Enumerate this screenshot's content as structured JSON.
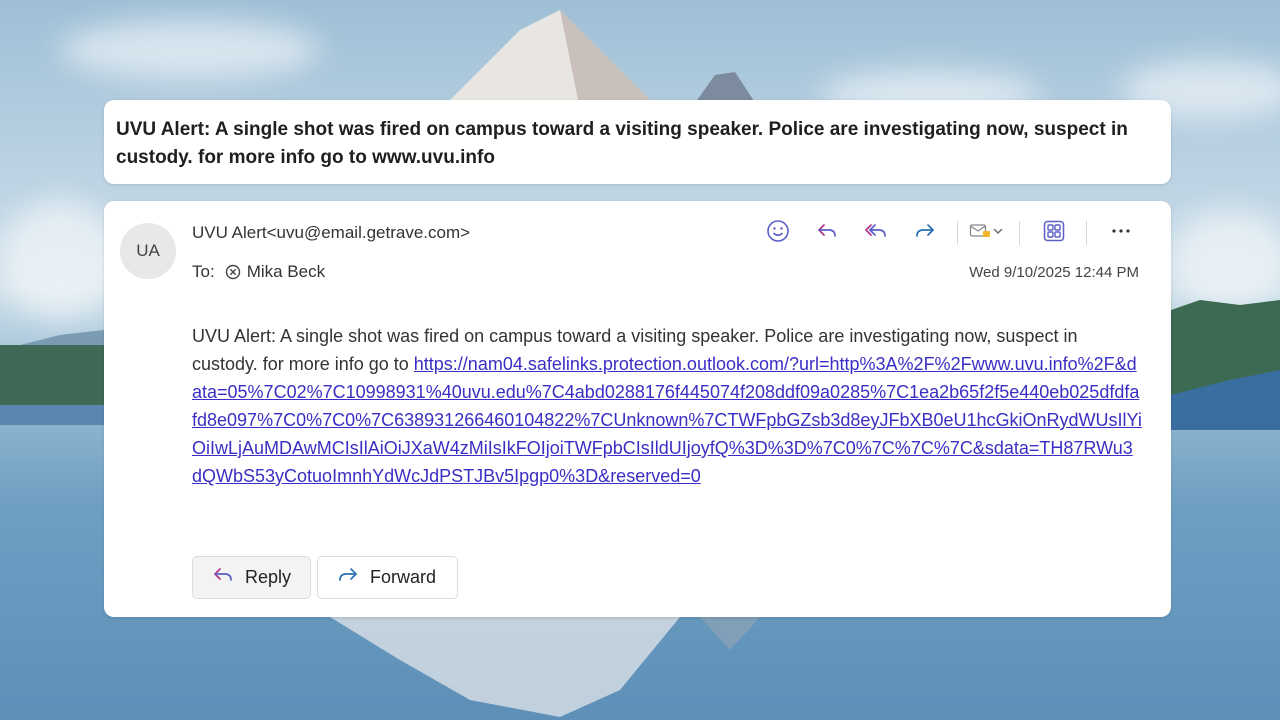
{
  "subject": "UVU Alert: A single shot was fired on campus toward a visiting speaker. Police are investigating now, suspect in custody. for more info go to www.uvu.info",
  "message": {
    "avatar_initials": "UA",
    "from": "UVU Alert<uvu@email.getrave.com>",
    "to_label": "To:",
    "recipient": "Mika Beck",
    "date": "Wed 9/10/2025 12:44 PM",
    "body_text": "UVU Alert: A single shot was fired on campus toward a visiting speaker. Police are investigating now, suspect in custody. for more info go to ",
    "body_link": "https://nam04.safelinks.protection.outlook.com/?url=http%3A%2F%2Fwww.uvu.info%2F&data=05%7C02%7C10998931%40uvu.edu%7C4abd0288176f445074f208ddf09a0285%7C1ea2b65f2f5e440eb025dfdfafd8e097%7C0%7C0%7C638931266460104822%7CUnknown%7CTWFpbGZsb3d8eyJFbXB0eU1hcGkiOnRydWUsIlYiOiIwLjAuMDAwMCIsIlAiOiJXaW4zMiIsIkFOIjoiTWFpbCIsIldUIjoyfQ%3D%3D%7C0%7C%7C%7C&sdata=TH87RWu3dQWbS53yCotuoImnhYdWcJdPSTJBv5Ipgp0%3D&reserved=0"
  },
  "toolbar": {
    "icons": [
      "emoji-icon",
      "reply-icon",
      "reply-all-icon",
      "forward-icon",
      "apps-mail-icon",
      "chevron-down-icon",
      "immersive-reader-icon",
      "more-icon"
    ],
    "accent_color": "#5b5fc7",
    "forward_color": "#2a6fb5"
  },
  "actions": {
    "reply_label": "Reply",
    "forward_label": "Forward"
  }
}
